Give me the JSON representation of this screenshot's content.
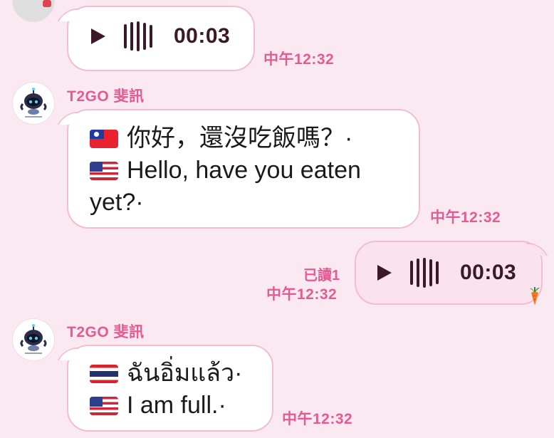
{
  "messages": [
    {
      "id": "partial_audio",
      "direction": "incoming",
      "duration": "00:03",
      "time": "中午12:32"
    },
    {
      "id": "bot_reply_1",
      "direction": "incoming",
      "sender": "T2GO 斐訊",
      "lines": [
        {
          "flag": "taiwan-flag-icon",
          "text": "你好，還沒吃飯嗎？·"
        },
        {
          "flag": "us-flag-icon",
          "text": "Hello, have you eaten"
        },
        {
          "flag": "",
          "text": "yet?·"
        }
      ],
      "time": "中午12:32"
    },
    {
      "id": "my_audio",
      "direction": "outgoing",
      "read_status": "已讀1",
      "duration": "00:03",
      "time": "中午12:32"
    },
    {
      "id": "bot_reply_2",
      "direction": "incoming",
      "sender": "T2GO 斐訊",
      "lines": [
        {
          "flag": "thailand-flag-icon",
          "text": "ฉันอิ่มแล้ว·"
        },
        {
          "flag": "us-flag-icon",
          "text": "I am full.·"
        }
      ],
      "time": "中午12:32"
    }
  ],
  "colors": {
    "background": "#fbe9f1",
    "accent": "#e45b93",
    "bubble_border": "#f3bcd3",
    "incoming_bubble": "#ffffff",
    "outgoing_bubble": "#fbe3ee",
    "icon_dark": "#3a1a28"
  }
}
